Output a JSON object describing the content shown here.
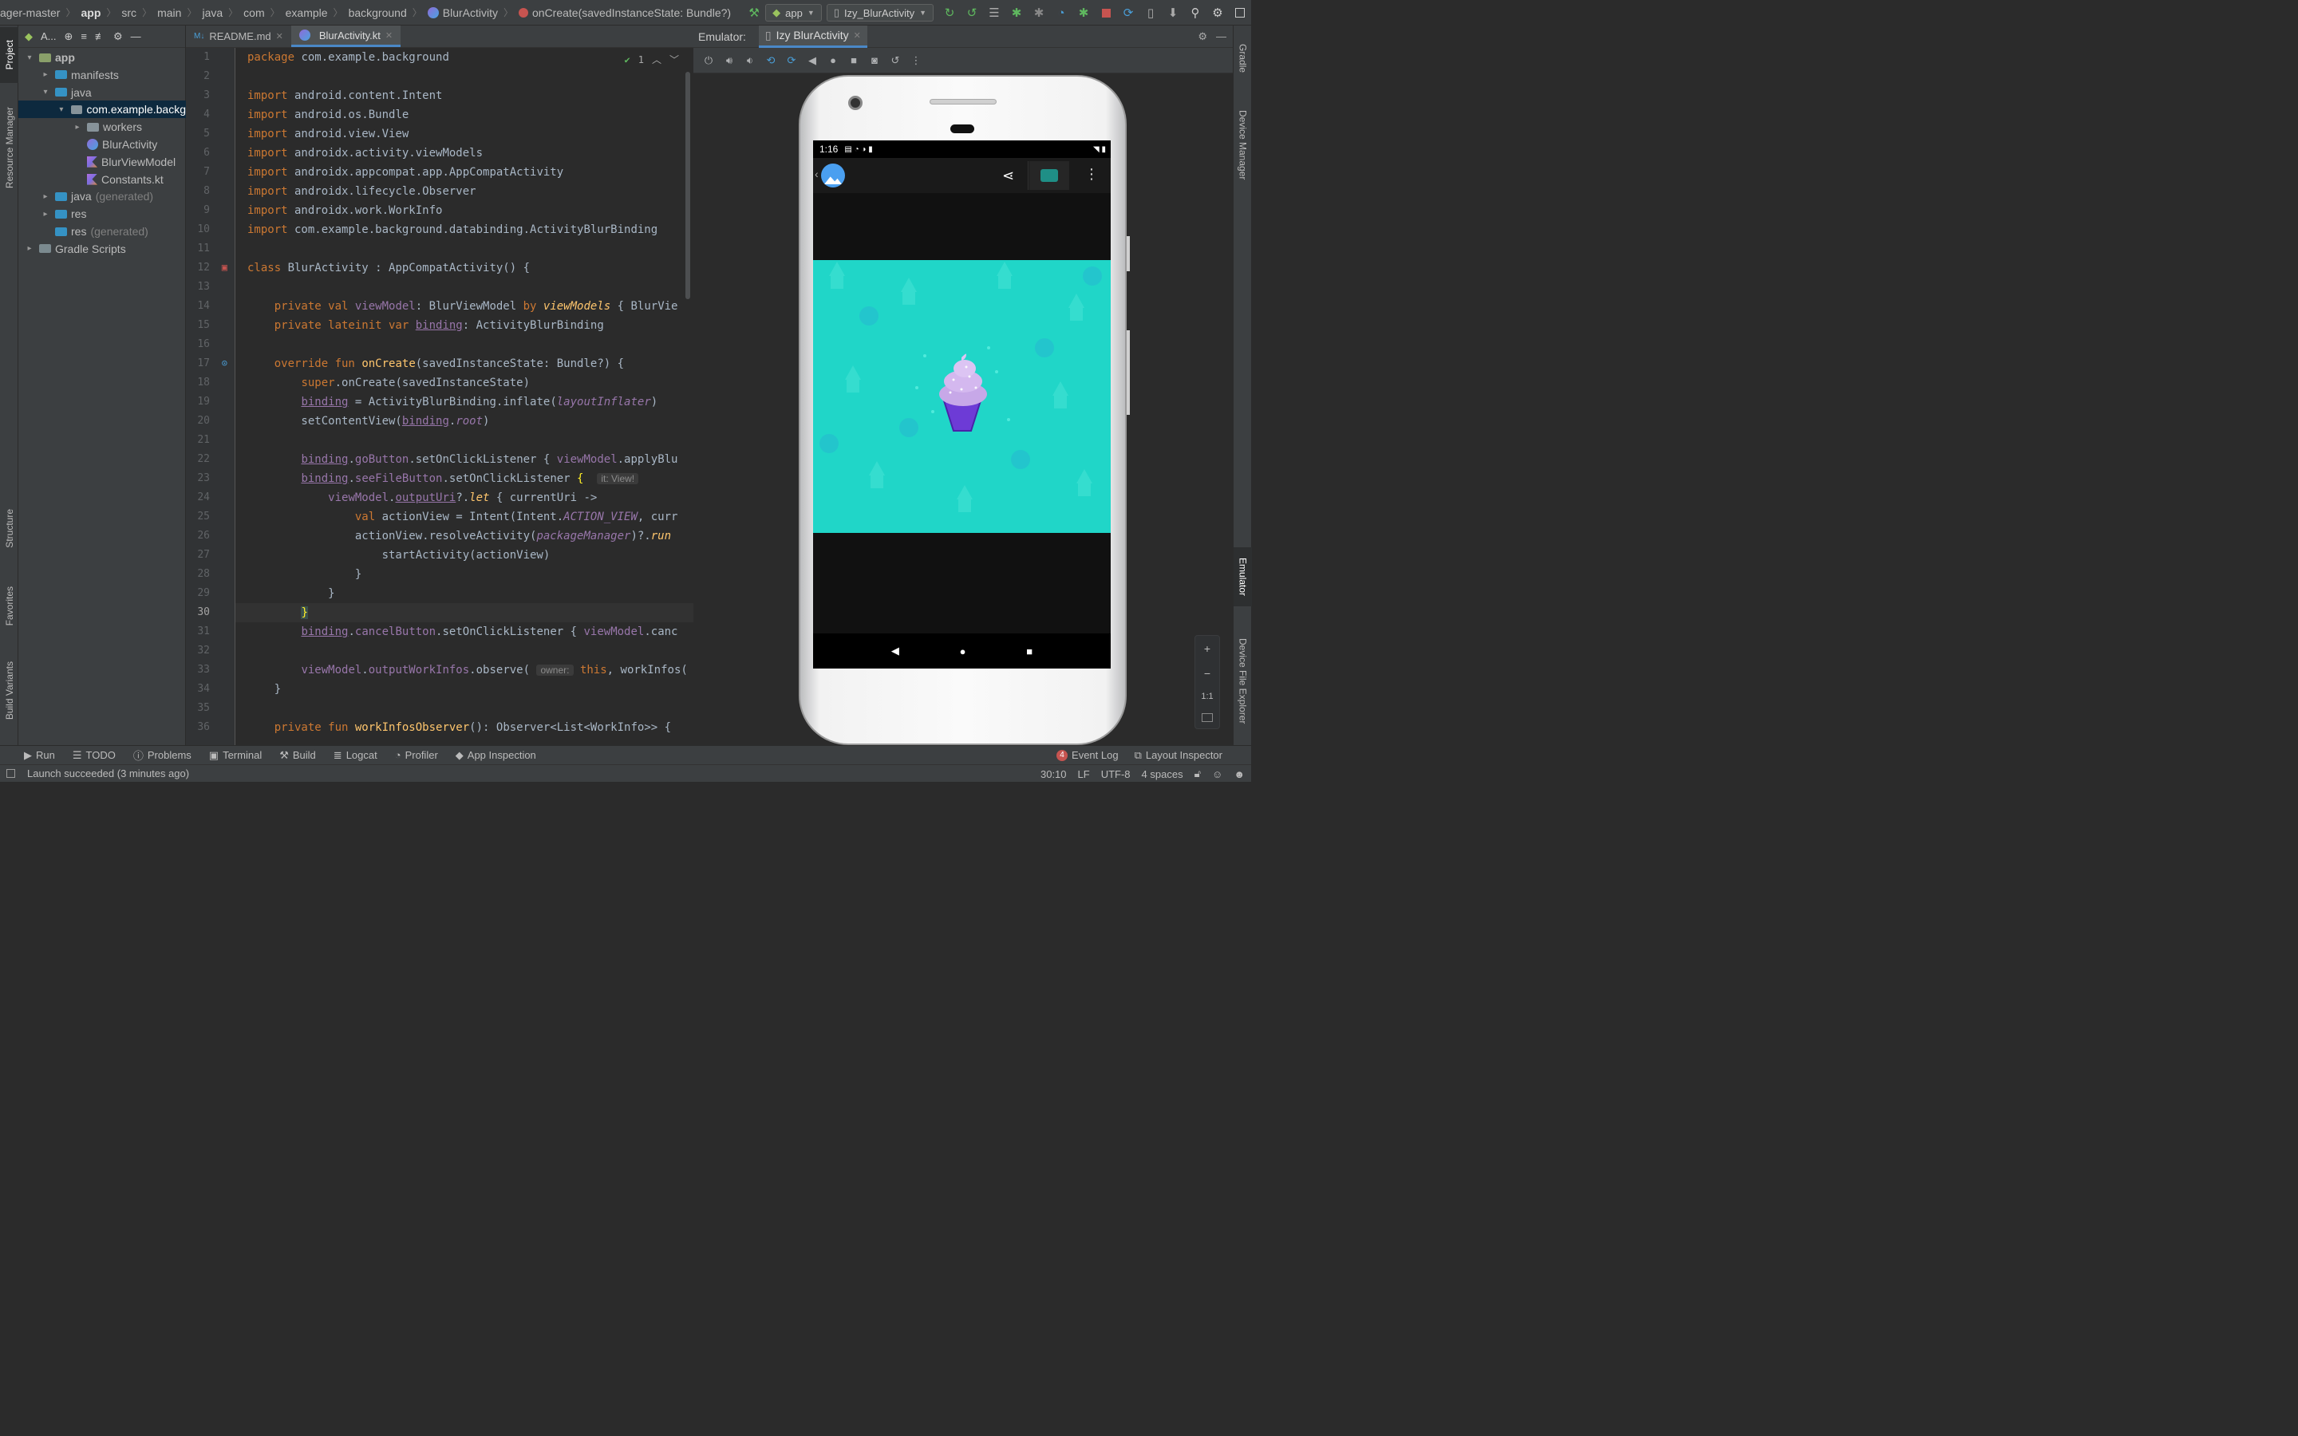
{
  "breadcrumb": [
    "ager-master",
    "app",
    "src",
    "main",
    "java",
    "com",
    "example",
    "background",
    "BlurActivity",
    "onCreate(savedInstanceState: Bundle?)"
  ],
  "toolbar": {
    "run_config": "app",
    "device": "Izy_BlurActivity"
  },
  "left_tabs": [
    "Project",
    "Resource Manager",
    "Structure",
    "Favorites",
    "Build Variants"
  ],
  "project_panel": {
    "header": "A...",
    "tree": [
      {
        "label": "app",
        "indent": 0,
        "expanded": true
      },
      {
        "label": "manifests",
        "indent": 1,
        "expanded": false
      },
      {
        "label": "java",
        "indent": 1,
        "expanded": true
      },
      {
        "label": "com.example.backg",
        "indent": 2,
        "expanded": true,
        "selected": true
      },
      {
        "label": "workers",
        "indent": 3,
        "expanded": false
      },
      {
        "label": "BlurActivity",
        "indent": 3
      },
      {
        "label": "BlurViewModel",
        "indent": 3
      },
      {
        "label": "Constants.kt",
        "indent": 3
      },
      {
        "label": "java",
        "suffix": "(generated)",
        "indent": 1,
        "expanded": false
      },
      {
        "label": "res",
        "indent": 1,
        "expanded": false
      },
      {
        "label": "res",
        "suffix": "(generated)",
        "indent": 1
      },
      {
        "label": "Gradle Scripts",
        "indent": 0,
        "expanded": false
      }
    ]
  },
  "editor_tabs": [
    {
      "label": "README.md",
      "active": false
    },
    {
      "label": "BlurActivity.kt",
      "active": true
    }
  ],
  "editor": {
    "inspection_count": "1",
    "current_line": 30,
    "line_numbers": [
      "1",
      "2",
      "3",
      "4",
      "5",
      "6",
      "7",
      "8",
      "9",
      "10",
      "11",
      "12",
      "13",
      "14",
      "15",
      "16",
      "17",
      "18",
      "19",
      "20",
      "21",
      "22",
      "23",
      "24",
      "25",
      "26",
      "27",
      "28",
      "29",
      "30",
      "31",
      "32",
      "33",
      "34",
      "35",
      "36"
    ],
    "hint_it": "it: View!",
    "hint_owner": "owner:"
  },
  "emulator": {
    "label": "Emulator:",
    "tab": "Izy BlurActivity",
    "status_time": "1:16"
  },
  "right_tabs": [
    "Gradle",
    "Device Manager",
    "Emulator",
    "Device File Explorer"
  ],
  "zoom_controls": [
    "+",
    "−",
    "1:1"
  ],
  "bottom_tabs": [
    "Run",
    "TODO",
    "Problems",
    "Terminal",
    "Build",
    "Logcat",
    "Profiler",
    "App Inspection"
  ],
  "bottom_right": {
    "event_log_count": "4",
    "event_log": "Event Log",
    "layout_inspector": "Layout Inspector"
  },
  "status": {
    "message": "Launch succeeded (3 minutes ago)",
    "position": "30:10",
    "line_sep": "LF",
    "encoding": "UTF-8",
    "indent": "4 spaces"
  },
  "colors": {
    "accent": "#4a88c7",
    "teal_image": "#20d6c8",
    "cupcake": "#7b4fd0"
  }
}
